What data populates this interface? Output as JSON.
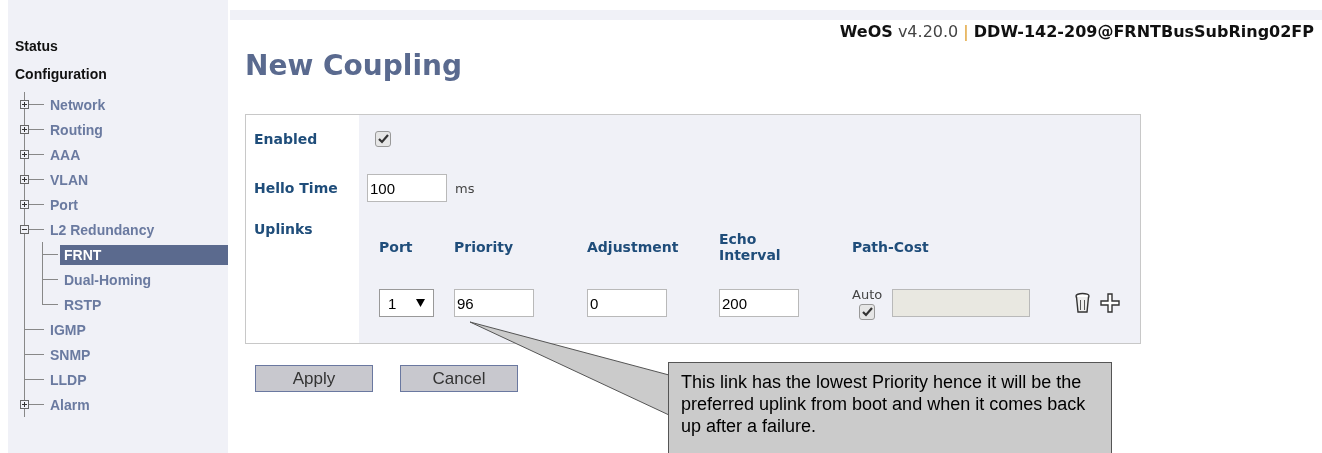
{
  "header": {
    "product": "WeOS",
    "version": "v4.20.0",
    "separator": "|",
    "device": "DDW-142-209@FRNTBusSubRing02FP"
  },
  "sidebar": {
    "sections": [
      {
        "label": "Status"
      },
      {
        "label": "Configuration"
      }
    ],
    "tree": [
      {
        "label": "Network",
        "kind": "folder",
        "expanded": false,
        "selected": false
      },
      {
        "label": "Routing",
        "kind": "folder",
        "expanded": false,
        "selected": false
      },
      {
        "label": "AAA",
        "kind": "folder",
        "expanded": false,
        "selected": false
      },
      {
        "label": "VLAN",
        "kind": "folder",
        "expanded": false,
        "selected": false
      },
      {
        "label": "Port",
        "kind": "folder",
        "expanded": false,
        "selected": false
      },
      {
        "label": "L2 Redundancy",
        "kind": "folder",
        "expanded": true,
        "selected": false,
        "children": [
          {
            "label": "FRNT",
            "selected": true
          },
          {
            "label": "Dual-Homing",
            "selected": false
          },
          {
            "label": "RSTP",
            "selected": false
          }
        ]
      },
      {
        "label": "IGMP",
        "kind": "leaf",
        "selected": false
      },
      {
        "label": "SNMP",
        "kind": "leaf",
        "selected": false
      },
      {
        "label": "LLDP",
        "kind": "leaf",
        "selected": false
      },
      {
        "label": "Alarm",
        "kind": "folder",
        "expanded": false,
        "selected": false
      }
    ]
  },
  "page": {
    "title": "New Coupling"
  },
  "form": {
    "enabled": {
      "label": "Enabled",
      "checked": true
    },
    "hello_time": {
      "label": "Hello Time",
      "value": "100",
      "unit": "ms"
    },
    "uplinks": {
      "label": "Uplinks",
      "columns": [
        "Port",
        "Priority",
        "Adjustment",
        "Echo Interval",
        "Path-Cost"
      ],
      "rows": [
        {
          "port": "1",
          "priority": "96",
          "adjustment": "0",
          "echo_interval": "200",
          "auto_label": "Auto",
          "auto_checked": true,
          "path_cost_disabled": true
        }
      ]
    }
  },
  "buttons": [
    {
      "label": "Apply"
    },
    {
      "label": "Cancel"
    }
  ],
  "callout": {
    "text": "This link has the lowest Priority hence it will be the preferred uplink from boot and when it comes back up after a failure."
  }
}
